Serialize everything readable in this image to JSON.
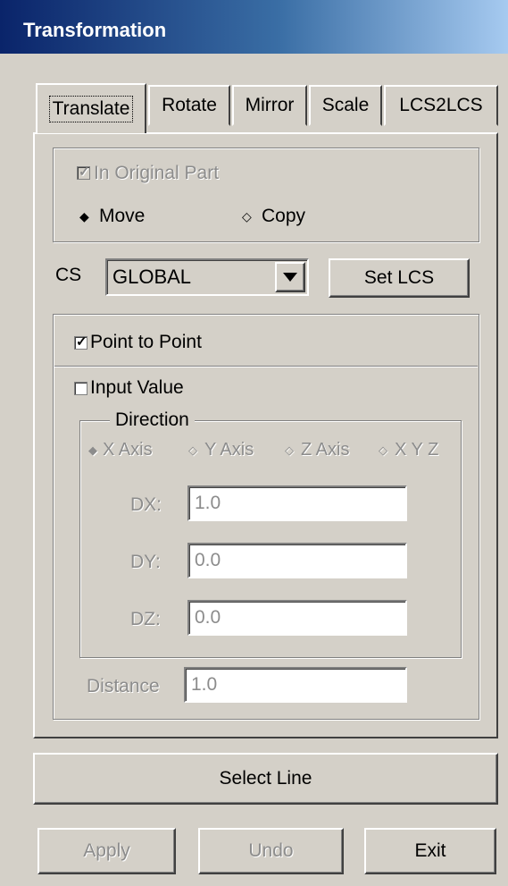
{
  "window": {
    "title": "Transformation"
  },
  "tabs": [
    {
      "label": "Translate",
      "active": true
    },
    {
      "label": "Rotate"
    },
    {
      "label": "Mirror"
    },
    {
      "label": "Scale"
    },
    {
      "label": "LCS2LCS"
    }
  ],
  "mode_group": {
    "in_original_part": {
      "label": "In Original Part",
      "checked": true,
      "enabled": false
    },
    "move": {
      "label": "Move",
      "selected": true
    },
    "copy": {
      "label": "Copy",
      "selected": false
    }
  },
  "cs": {
    "label": "CS",
    "value": "GLOBAL",
    "set_lcs_label": "Set LCS"
  },
  "point_to_point": {
    "label": "Point to Point",
    "checked": true
  },
  "input_value": {
    "label": "Input Value",
    "checked": false
  },
  "direction": {
    "label": "Direction",
    "options": [
      "X Axis",
      "Y Axis",
      "Z Axis",
      "X Y Z"
    ],
    "selected": "X Axis",
    "dx_label": "DX:",
    "dx_value": "1.0",
    "dy_label": "DY:",
    "dy_value": "0.0",
    "dz_label": "DZ:",
    "dz_value": "0.0"
  },
  "distance": {
    "label": "Distance",
    "value": "1.0"
  },
  "buttons": {
    "select_line": "Select Line",
    "apply": "Apply",
    "undo": "Undo",
    "exit": "Exit"
  },
  "colors": {
    "title_bar_start": "#0a246a",
    "title_bar_end": "#a6caf0",
    "face": "#d4d0c8",
    "disabled_text": "#8c8c8c"
  }
}
